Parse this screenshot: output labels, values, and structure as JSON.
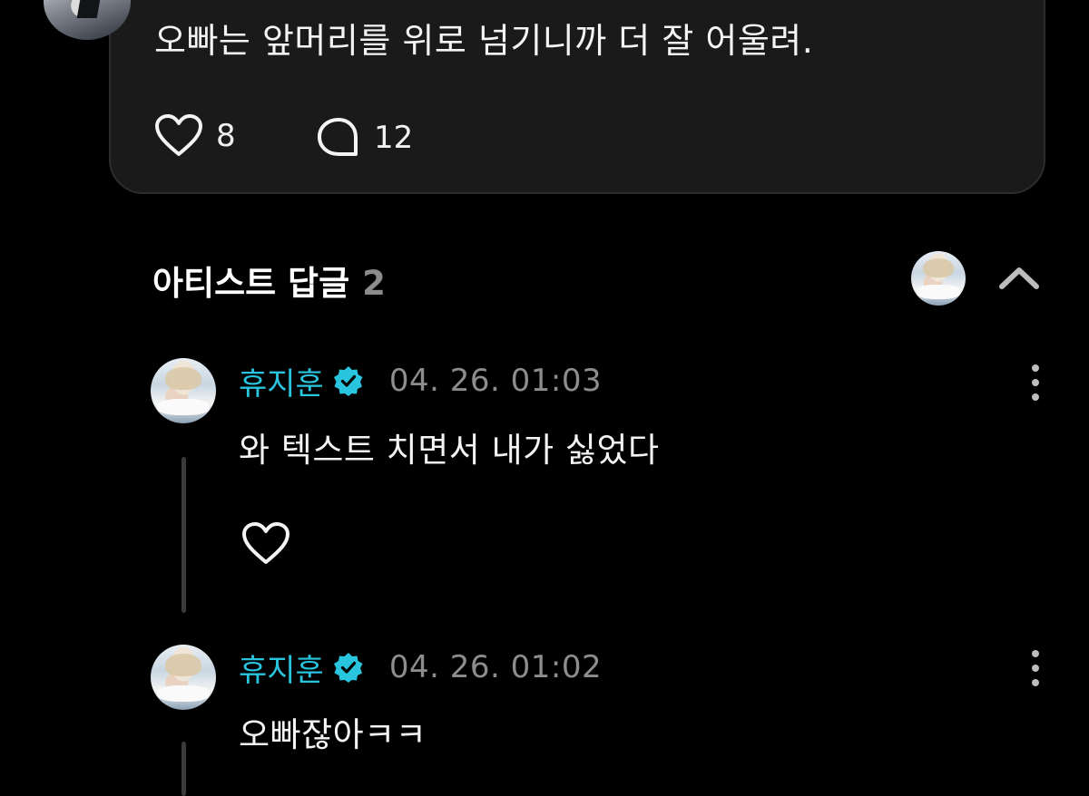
{
  "post": {
    "text": "오빠는 앞머리를 위로 넘기니까 더 잘 어울려.",
    "likes": "8",
    "comments": "12",
    "like_icon": "heart-icon",
    "comment_icon": "comment-bubble-icon"
  },
  "section": {
    "title": "아티스트 답글",
    "count": "2",
    "collapse_icon": "chevron-up-icon"
  },
  "replies": [
    {
      "author": "휴지훈",
      "verified": true,
      "time": "04. 26. 01:03",
      "text": "와 텍스트 치면서 내가 싫었다",
      "like_icon": "heart-icon"
    },
    {
      "author": "휴지훈",
      "verified": true,
      "time": "04. 26. 01:02",
      "text": "오빠잖아ㅋㅋ"
    }
  ],
  "colors": {
    "background": "#000000",
    "card": "#1a1a1a",
    "artist_name": "#29c5de",
    "verified_badge": "#29c5de",
    "muted": "#8d8d8d"
  }
}
